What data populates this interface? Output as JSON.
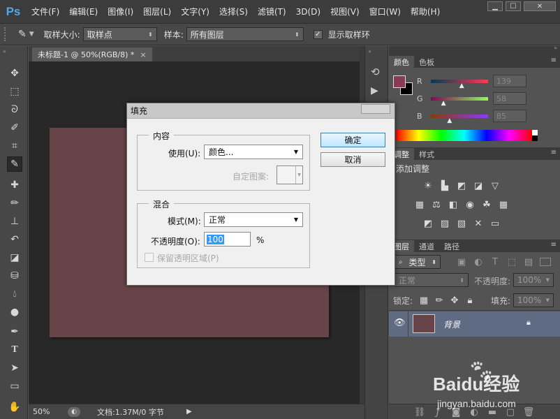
{
  "app": {
    "logo": "Ps"
  },
  "menu": [
    "文件(F)",
    "编辑(E)",
    "图像(I)",
    "图层(L)",
    "文字(Y)",
    "选择(S)",
    "滤镜(T)",
    "3D(D)",
    "视图(V)",
    "窗口(W)",
    "帮助(H)"
  ],
  "window_controls": {
    "minimize": "▁",
    "maximize": "☐",
    "close": "✕"
  },
  "options": {
    "sample_size_label": "取样大小:",
    "sample_size_value": "取样点",
    "sample_label": "样本:",
    "sample_value": "所有图层",
    "show_ring_label": "显示取样环",
    "show_ring_checked": "✓"
  },
  "document": {
    "tab_title": "未标题-1 @ 50%(RGB/8) *",
    "tab_close": "×",
    "canvas_color": "#684448"
  },
  "status": {
    "zoom": "50%",
    "doc_info": "文档:1.37M/0 字节"
  },
  "color_panel": {
    "tabs": [
      "颜色",
      "色板"
    ],
    "r_label": "R",
    "r_value": "139",
    "g_label": "G",
    "g_value": "58",
    "b_label": "B",
    "b_value": "85",
    "foreground": "#8b3a55",
    "background": "#000000"
  },
  "adjust_panel": {
    "tabs": [
      "调整",
      "样式"
    ],
    "title": "添加调整"
  },
  "layers_panel": {
    "tabs": [
      "图层",
      "通道",
      "路径"
    ],
    "kind_filter": "类型",
    "blend_mode": "正常",
    "opacity_label": "不透明度:",
    "opacity_value": "100%",
    "lock_label": "锁定:",
    "fill_label": "填充:",
    "fill_value": "100%",
    "layer_name": "背景"
  },
  "dialog": {
    "title": "填充",
    "content_group": "内容",
    "use_label": "使用(U):",
    "use_value": "颜色...",
    "custom_pattern_label": "自定图案:",
    "blend_group": "混合",
    "mode_label": "模式(M):",
    "mode_value": "正常",
    "opacity_label": "不透明度(O):",
    "opacity_value": "100",
    "percent": "%",
    "preserve_label": "保留透明区域(P)",
    "ok_label": "确定",
    "cancel_label": "取消"
  },
  "watermark": {
    "brand": "Baidu经验",
    "url": "jingyan.baidu.com"
  }
}
